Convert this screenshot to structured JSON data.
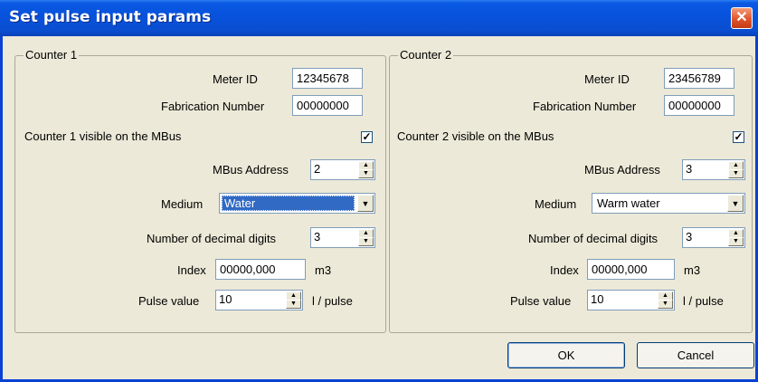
{
  "window": {
    "title": "Set pulse input params",
    "close_glyph": "✕"
  },
  "counters": [
    {
      "legend": "Counter 1",
      "meter_id_label": "Meter ID",
      "meter_id": "12345678",
      "fab_label": "Fabrication Number",
      "fab_number": "00000000",
      "visible_label": "Counter 1 visible on the MBus",
      "visible_checked": true,
      "mbus_label": "MBus Address",
      "mbus_address": "2",
      "medium_label": "Medium",
      "medium": "Water",
      "medium_highlighted": true,
      "digits_label": "Number of decimal digits",
      "digits": "3",
      "index_label": "Index",
      "index": "00000,000",
      "index_unit": "m3",
      "pulse_label": "Pulse value",
      "pulse": "10",
      "pulse_unit": "l / pulse"
    },
    {
      "legend": "Counter 2",
      "meter_id_label": "Meter ID",
      "meter_id": "23456789",
      "fab_label": "Fabrication Number",
      "fab_number": "00000000",
      "visible_label": "Counter 2 visible on the MBus",
      "visible_checked": true,
      "mbus_label": "MBus Address",
      "mbus_address": "3",
      "medium_label": "Medium",
      "medium": "Warm water",
      "medium_highlighted": false,
      "digits_label": "Number of decimal digits",
      "digits": "3",
      "index_label": "Index",
      "index": "00000,000",
      "index_unit": "m3",
      "pulse_label": "Pulse value",
      "pulse": "10",
      "pulse_unit": "l / pulse"
    }
  ],
  "buttons": {
    "ok": "OK",
    "cancel": "Cancel"
  },
  "glyphs": {
    "check": "✓",
    "up": "▲",
    "down": "▼"
  }
}
